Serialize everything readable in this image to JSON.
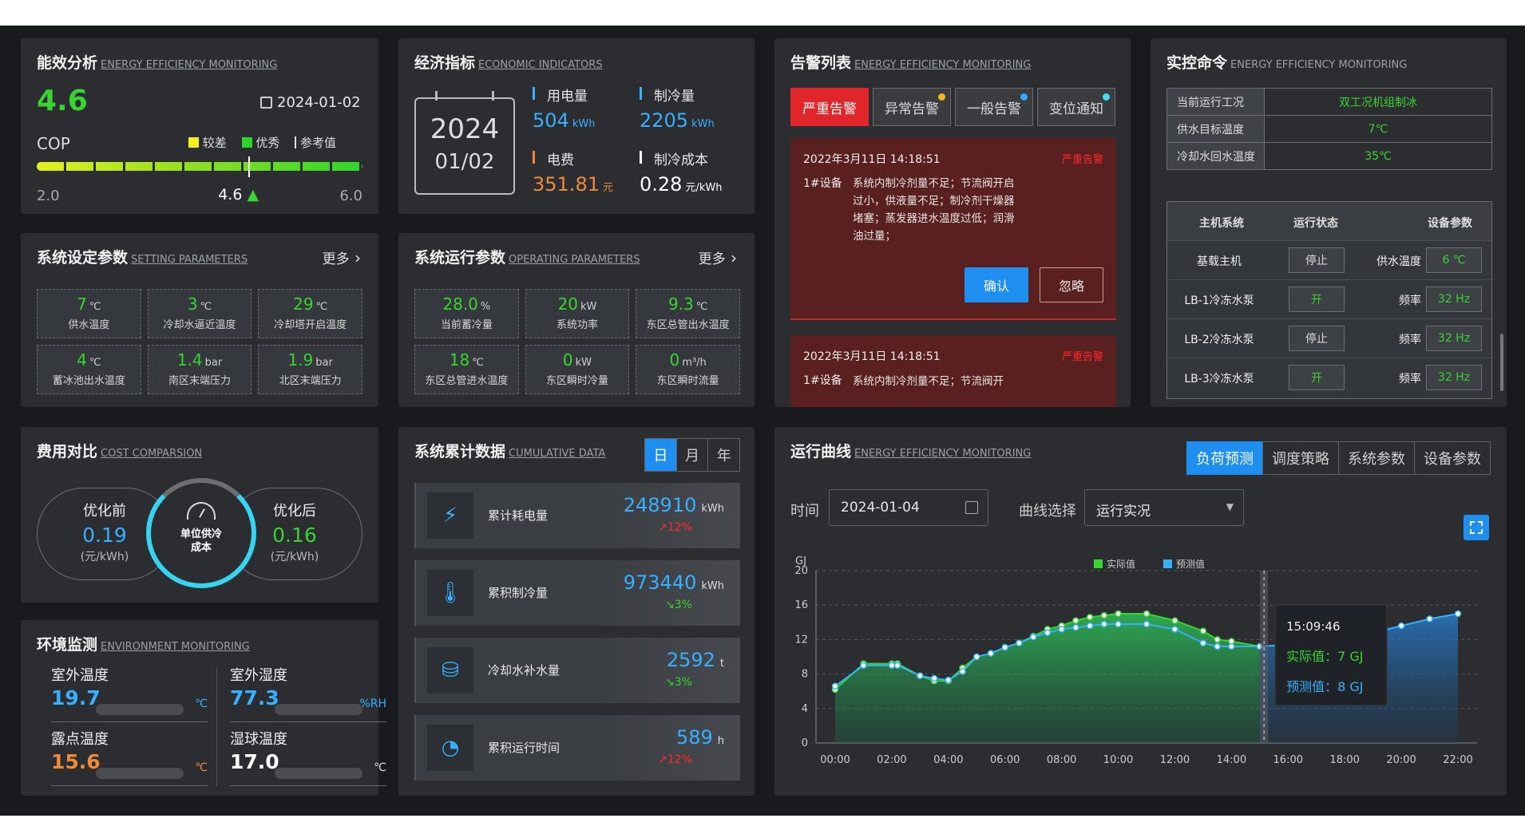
{
  "efficiency": {
    "title": "能效分析",
    "en": "ENERGY EFFICIENCY MONITORING",
    "cop_value": "4.6",
    "cop_label": "COP",
    "date": "2024-01-02",
    "legend": [
      "较差",
      "优秀",
      "参考值"
    ],
    "min": "2.0",
    "current": "4.6",
    "max": "6.0",
    "position": 0.65
  },
  "economic": {
    "title": "经济指标",
    "en": "ECONOMIC INDICATORS",
    "cal_year": "2024",
    "cal_day": "01/02",
    "items": [
      {
        "label": "用电量",
        "value": "504",
        "unit": "kWh"
      },
      {
        "label": "制冷量",
        "value": "2205",
        "unit": "kWh"
      },
      {
        "label": "电费",
        "value": "351.81",
        "unit": "元"
      },
      {
        "label": "制冷成本",
        "value": "0.28",
        "unit": "元/kWh"
      }
    ]
  },
  "alarms": {
    "title": "告警列表",
    "en": "ENERGY EFFICIENCY MONITORING",
    "tabs": [
      "严重告警",
      "异常告警",
      "一般告警",
      "变位通知"
    ],
    "items": [
      {
        "time": "2022年3月11日  14:18:51",
        "level": "严重告警",
        "device": "1#设备",
        "text": "系统内制冷剂量不足；节流阀开启过小，供液量不足；制冷剂干燥器堵塞；蒸发器进水温度过低；润滑油过量；",
        "confirm": "确认",
        "ignore": "忽略"
      },
      {
        "time": "2022年3月11日  14:18:51",
        "level": "严重告警",
        "device": "1#设备",
        "text": "系统内制冷剂量不足；节流阀开"
      }
    ]
  },
  "control": {
    "title": "实控命令",
    "en": "ENERGY EFFICIENCY MONITORING",
    "info": [
      {
        "k": "当前运行工况",
        "v": "双工况机组制冰"
      },
      {
        "k": "供水目标温度",
        "v": "7℃"
      },
      {
        "k": "冷却水回水温度",
        "v": "35℃"
      }
    ],
    "headers": [
      "主机系统",
      "运行状态",
      "设备参数"
    ],
    "rows": [
      {
        "name": "基载主机",
        "state": "停止",
        "pname": "供水温度",
        "pval": "6 ℃"
      },
      {
        "name": "LB-1冷冻水泵",
        "state": "开",
        "pname": "频率",
        "pval": "32 Hz"
      },
      {
        "name": "LB-2冷冻水泵",
        "state": "停止",
        "pname": "频率",
        "pval": "32 Hz"
      },
      {
        "name": "LB-3冷冻水泵",
        "state": "开",
        "pname": "频率",
        "pval": "32 Hz"
      }
    ]
  },
  "setting": {
    "title": "系统设定参数",
    "en": "SETTING PARAMETERS",
    "more": "更多",
    "items": [
      {
        "v": "7",
        "u": "℃",
        "l": "供水温度"
      },
      {
        "v": "3",
        "u": "℃",
        "l": "冷却水逼近温度"
      },
      {
        "v": "29",
        "u": "℃",
        "l": "冷却塔开启温度"
      },
      {
        "v": "4",
        "u": "℃",
        "l": "蓄冰池出水温度"
      },
      {
        "v": "1.4",
        "u": "bar",
        "l": "南区末端压力"
      },
      {
        "v": "1.9",
        "u": "bar",
        "l": "北区末端压力"
      }
    ]
  },
  "operating": {
    "title": "系统运行参数",
    "en": "OPERATING PARAMETERS",
    "more": "更多",
    "items": [
      {
        "v": "28.0",
        "u": "%",
        "l": "当前蓄冷量"
      },
      {
        "v": "20",
        "u": "kW",
        "l": "系统功率"
      },
      {
        "v": "9.3",
        "u": "℃",
        "l": "东区总管出水温度"
      },
      {
        "v": "18",
        "u": "℃",
        "l": "东区总管进水温度"
      },
      {
        "v": "0",
        "u": "kW",
        "l": "东区瞬时冷量"
      },
      {
        "v": "0",
        "u": "m³/h",
        "l": "东区瞬时流量"
      }
    ]
  },
  "cost": {
    "title": "费用对比",
    "en": "COST COMPARSION",
    "before_label": "优化前",
    "before_value": "0.19",
    "before_unit": "(元/kWh)",
    "center": "单位供冷成本",
    "after_label": "优化后",
    "after_value": "0.16",
    "after_unit": "(元/kWh)"
  },
  "cumulative": {
    "title": "系统累计数据",
    "en": "CUMULATIVE DATA",
    "periods": [
      "日",
      "月",
      "年"
    ],
    "items": [
      {
        "label": "累计耗电量",
        "value": "248910",
        "unit": "kWh",
        "trend": "↗12%",
        "trend_color": "#ff2b2b"
      },
      {
        "label": "累积制冷量",
        "value": "973440",
        "unit": "kWh",
        "trend": "↘3%",
        "trend_color": "#38d430"
      },
      {
        "label": "冷却水补水量",
        "value": "2592",
        "unit": "t",
        "trend": "↘3%",
        "trend_color": "#38d430"
      },
      {
        "label": "累积运行时间",
        "value": "589",
        "unit": "h",
        "trend": "↗12%",
        "trend_color": "#ff2b2b"
      }
    ]
  },
  "environment": {
    "title": "环境监测",
    "en": "ENVIRONMENT MONITORING",
    "items": [
      {
        "name": "室外温度",
        "value": "19.7",
        "unit": "℃",
        "color": "#36b0ff"
      },
      {
        "name": "室外湿度",
        "value": "77.3",
        "unit": "%RH",
        "color": "#36b0ff"
      },
      {
        "name": "露点温度",
        "value": "15.6",
        "unit": "℃",
        "color": "#f08a3a"
      },
      {
        "name": "湿球温度",
        "value": "17.0",
        "unit": "℃",
        "color": "#ffffff"
      }
    ]
  },
  "curve": {
    "title": "运行曲线",
    "en": "ENERGY EFFICIENCY MONITORING",
    "tabs": [
      "负荷预测",
      "调度策略",
      "系统参数",
      "设备参数"
    ],
    "time_label": "时间",
    "date": "2024-01-04",
    "select_label": "曲线选择",
    "select_value": "运行实况",
    "unit": "GJ",
    "legend_actual": "实际值",
    "legend_forecast": "预测值",
    "tooltip_time": "15:09:46",
    "tooltip_actual": "实际值：7 GJ",
    "tooltip_forecast": "预测值：8 GJ"
  },
  "chart_data": {
    "type": "line",
    "ylabel": "GJ",
    "ylim": [
      0,
      20
    ],
    "yticks": [
      0,
      4,
      8,
      12,
      16,
      20
    ],
    "xticks": [
      "00:00",
      "02:00",
      "04:00",
      "06:00",
      "08:00",
      "10:00",
      "12:00",
      "14:00",
      "16:00",
      "18:00",
      "20:00",
      "22:00"
    ],
    "series": [
      {
        "name": "实际值",
        "color": "#38d430",
        "x": [
          0,
          1,
          2,
          2.2,
          3,
          3.5,
          4,
          4.5,
          5,
          5.5,
          6,
          6.5,
          7,
          7.5,
          8,
          8.5,
          9,
          9.5,
          10,
          11,
          12,
          13,
          13.5,
          14,
          15
        ],
        "y": [
          6.2,
          9.2,
          9.2,
          9.2,
          7.8,
          7.2,
          7.2,
          8.7,
          10,
          10.4,
          11.1,
          11.6,
          12.4,
          13.2,
          13.6,
          14.2,
          14.6,
          14.8,
          15,
          15,
          14.2,
          13,
          12,
          11.8,
          11.2
        ]
      },
      {
        "name": "预测值",
        "color": "#36b0ff",
        "x": [
          0,
          1,
          2,
          2.2,
          3,
          3.5,
          4,
          4.5,
          5,
          5.5,
          6,
          6.5,
          7,
          7.5,
          8,
          8.5,
          9,
          9.5,
          10,
          11,
          12,
          13,
          13.5,
          14,
          15,
          16,
          17,
          18,
          19,
          20,
          21,
          22
        ],
        "y": [
          6.6,
          9,
          9,
          9,
          7.8,
          7.5,
          7.3,
          8.3,
          10,
          10.4,
          11.1,
          11.6,
          12.3,
          12.8,
          13.2,
          13.4,
          13.6,
          13.8,
          13.8,
          13.8,
          13.2,
          11.6,
          11.2,
          11.2,
          11.2,
          11.4,
          11.6,
          12.2,
          12.8,
          13.6,
          14.4,
          15
        ]
      }
    ],
    "cursor_x": 15.15
  }
}
